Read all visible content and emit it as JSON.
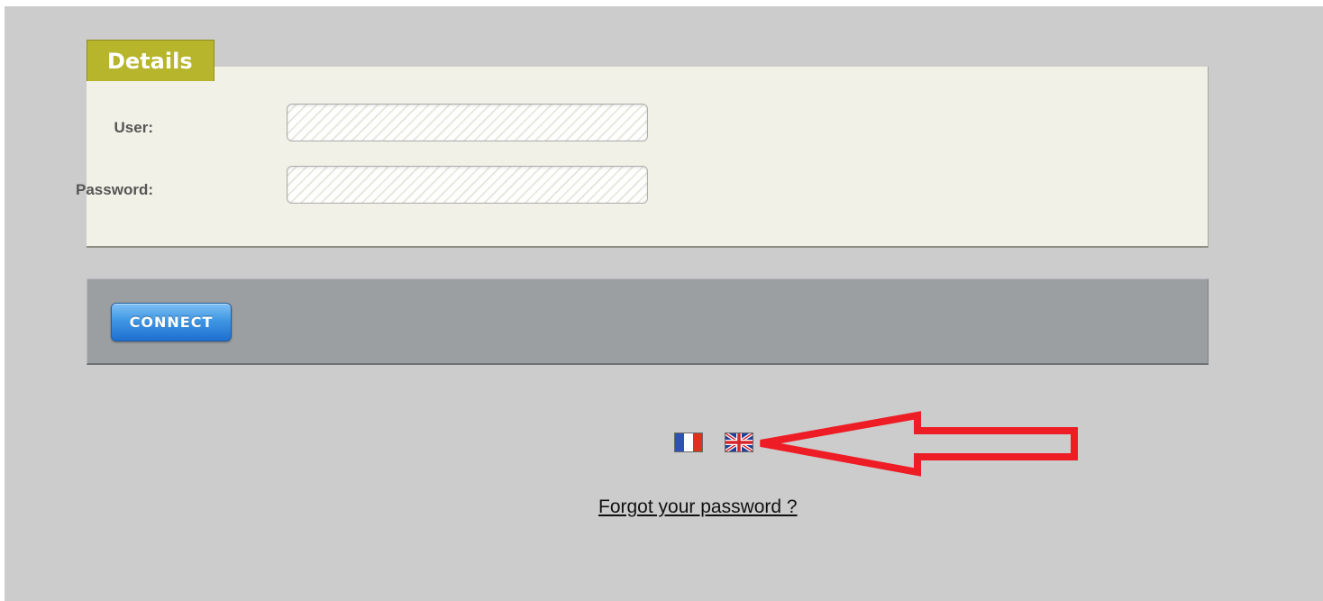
{
  "details": {
    "tab_title": "Details",
    "user_label": "User:",
    "user_value": "",
    "password_label": "Password:",
    "password_value": ""
  },
  "actions": {
    "connect_label": "CONNECT"
  },
  "languages": [
    {
      "name": "french-flag-icon",
      "colors": [
        "#2e52b2",
        "#ffffff",
        "#e0301e"
      ]
    },
    {
      "name": "uk-flag-icon",
      "colors": [
        "#1f3f9a",
        "#ffffff",
        "#d6262b"
      ]
    }
  ],
  "annotation": {
    "arrow_color": "#ee1c24",
    "icon": "arrow-left-icon"
  },
  "footer": {
    "forgot_password_label": "Forgot your password ?"
  },
  "colors": {
    "background": "#cccccc",
    "details_tab": "#b7b52c",
    "details_panel": "#f1f1e7",
    "action_bar": "#9c9fa2",
    "connect_button": "#3f97e4"
  }
}
